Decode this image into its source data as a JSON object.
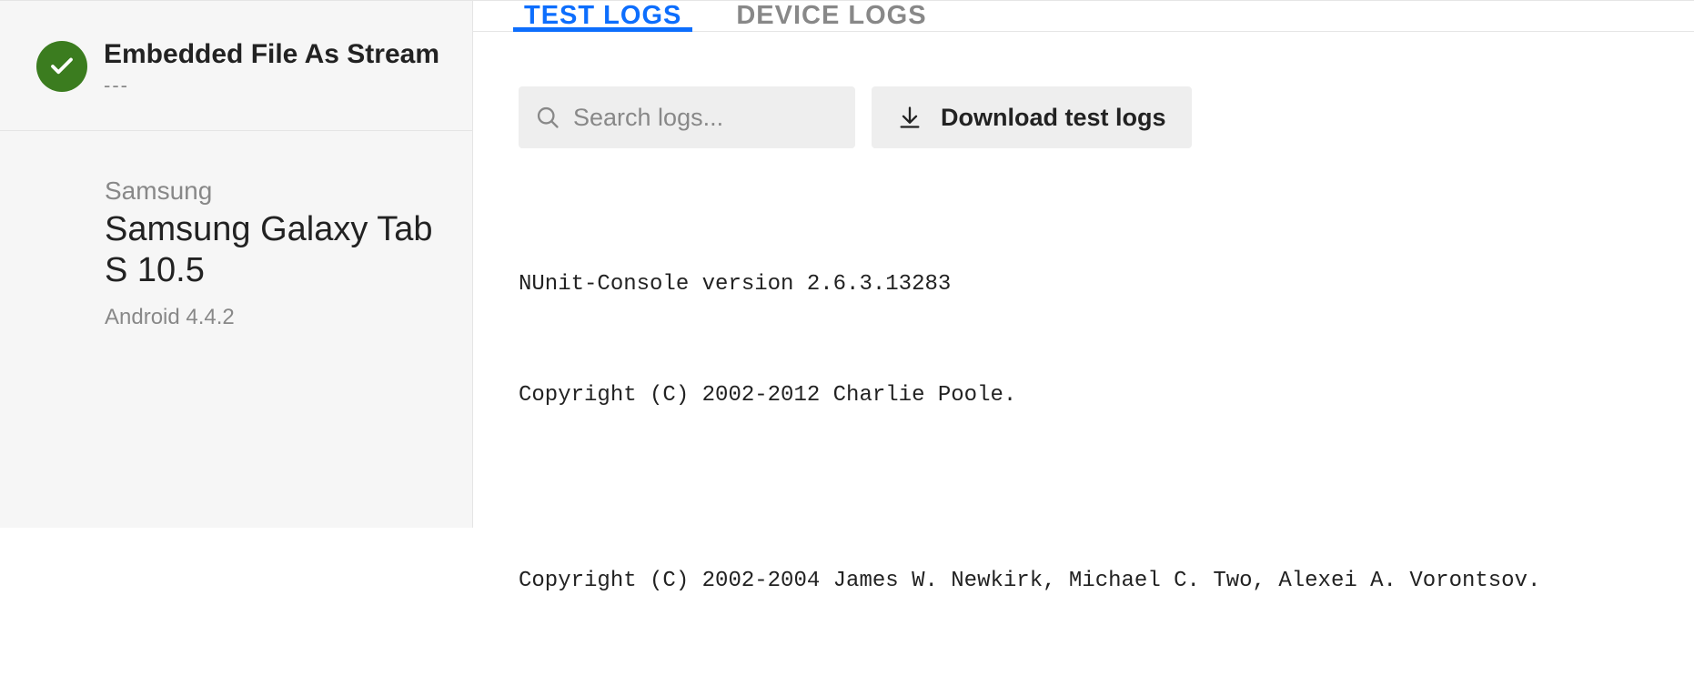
{
  "sidebar": {
    "test": {
      "title": "Embedded File As Stream",
      "subtitle": "---",
      "status": "passed"
    },
    "device": {
      "brand": "Samsung",
      "name": "Samsung Galaxy Tab S 10.5",
      "os": "Android 4.4.2"
    }
  },
  "tabs": [
    {
      "label": "TEST LOGS",
      "active": true
    },
    {
      "label": "DEVICE LOGS",
      "active": false
    }
  ],
  "toolbar": {
    "search_placeholder": "Search logs...",
    "download_label": "Download test logs"
  },
  "logs": [
    "NUnit-Console version 2.6.3.13283",
    "Copyright (C) 2002-2012 Charlie Poole.",
    "",
    "Copyright (C) 2002-2004 James W. Newkirk, Michael C. Two, Alexei A. Vorontsov."
  ]
}
